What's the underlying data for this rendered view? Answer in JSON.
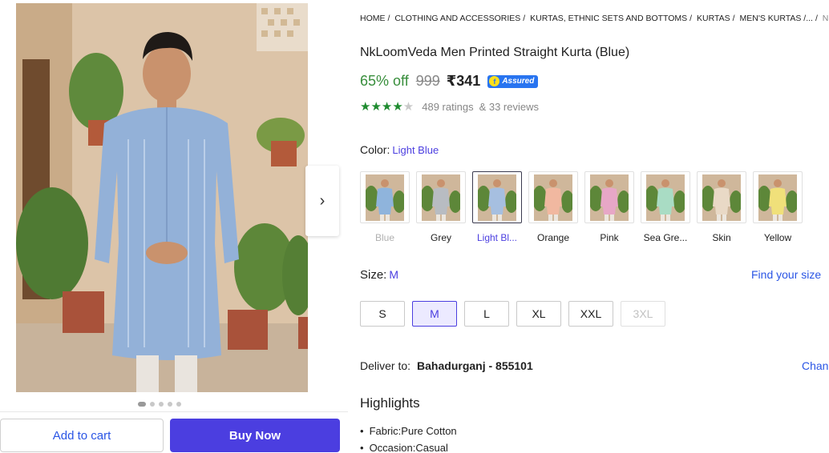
{
  "breadcrumbs": [
    "HOME",
    "CLOTHING AND ACCESSORIES",
    "KURTAS, ETHNIC SETS AND BOTTOMS",
    "KURTAS",
    "MEN'S KURTAS /...",
    "NKLO..."
  ],
  "product": {
    "title": "NkLoomVeda Men Printed Straight Kurta (Blue)",
    "discount": "65% off",
    "mrp": "999",
    "price": "₹341",
    "assured_badge": "Assured",
    "rating_stars": 4.5,
    "ratings_text": "489 ratings",
    "reviews_text": "& 33 reviews"
  },
  "gallery": {
    "image_count": 5,
    "active_index": 0,
    "next_icon": "chevron-right-icon"
  },
  "actions": {
    "add_to_cart": "Add to cart",
    "buy_now": "Buy Now"
  },
  "color": {
    "label": "Color:",
    "selected": "Light Blue",
    "options": [
      {
        "name": "Blue",
        "kurta": "#8fb4dc",
        "state": "unavailable"
      },
      {
        "name": "Grey",
        "kurta": "#b8bcc2",
        "state": "normal"
      },
      {
        "name": "Light Bl...",
        "kurta": "#a6bfe0",
        "state": "selected"
      },
      {
        "name": "Orange",
        "kurta": "#f1b8a0",
        "state": "normal"
      },
      {
        "name": "Pink",
        "kurta": "#e7a7c6",
        "state": "normal"
      },
      {
        "name": "Sea Gre...",
        "kurta": "#a9dcc4",
        "state": "normal"
      },
      {
        "name": "Skin",
        "kurta": "#e9d9c6",
        "state": "normal"
      },
      {
        "name": "Yellow",
        "kurta": "#f0e07a",
        "state": "normal"
      }
    ]
  },
  "size": {
    "label": "Size:",
    "selected": "M",
    "find_size": "Find your size",
    "options": [
      {
        "name": "S",
        "state": "normal"
      },
      {
        "name": "M",
        "state": "selected"
      },
      {
        "name": "L",
        "state": "normal"
      },
      {
        "name": "XL",
        "state": "normal"
      },
      {
        "name": "XXL",
        "state": "normal"
      },
      {
        "name": "3XL",
        "state": "disabled"
      }
    ]
  },
  "delivery": {
    "label": "Deliver to:",
    "place": "Bahadurganj - 855101",
    "change": "Chan"
  },
  "highlights": {
    "title": "Highlights",
    "items": [
      "Fabric:Pure Cotton",
      "Occasion:Casual"
    ]
  },
  "colors": {
    "accent": "#4b3ee0",
    "link": "#2a55e5",
    "discount_green": "#388e3c",
    "rating_green": "#1e8b2f",
    "assured_blue": "#2874f0"
  }
}
